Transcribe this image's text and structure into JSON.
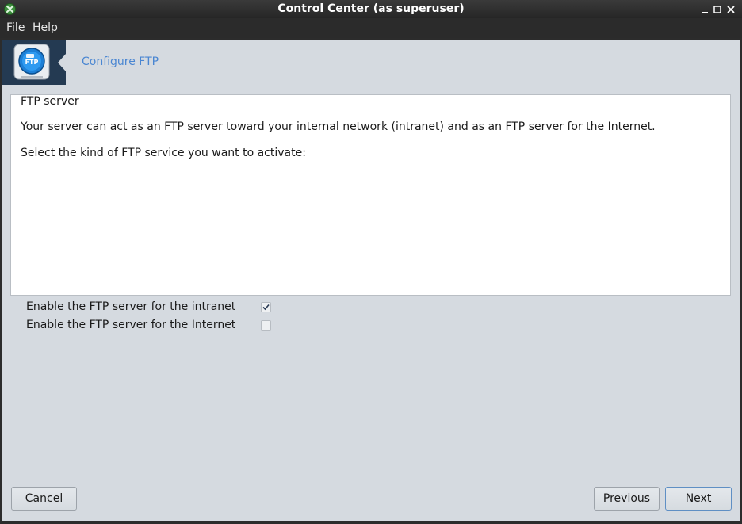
{
  "window": {
    "title": "Control Center (as superuser)"
  },
  "menubar": {
    "items": [
      {
        "label": "File"
      },
      {
        "label": "Help"
      }
    ]
  },
  "banner": {
    "title": "Configure FTP",
    "logo_icon": "ftp-server-icon",
    "logo_text": "FTP"
  },
  "panel": {
    "heading": "FTP server",
    "description": "Your server can act as an FTP server toward your internal network (intranet) and as an FTP server for the Internet.",
    "prompt": "Select the kind of FTP service you want to activate:"
  },
  "options": [
    {
      "label": "Enable the FTP server for the intranet",
      "checked": true
    },
    {
      "label": "Enable the FTP server for the Internet",
      "checked": false
    }
  ],
  "buttons": {
    "cancel": "Cancel",
    "previous": "Previous",
    "next": "Next"
  },
  "colors": {
    "accent": "#4a86d2",
    "background": "#d5dae0",
    "titlebar": "#2c2c2c"
  }
}
